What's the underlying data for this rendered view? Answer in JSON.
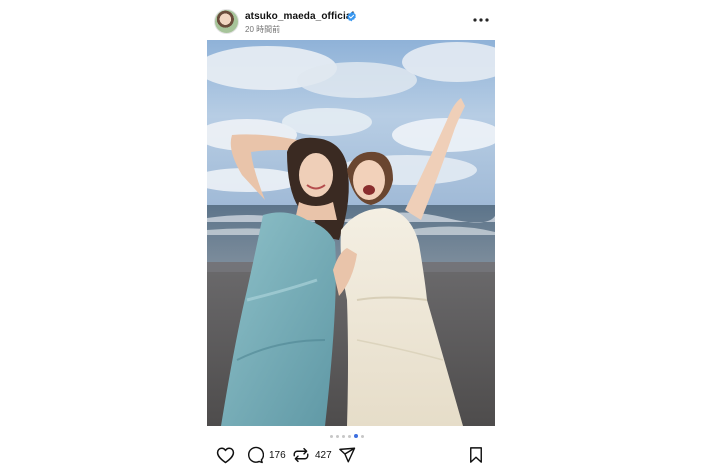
{
  "post": {
    "username": "atsuko_maeda_official",
    "time_ago": "20 時間前",
    "verified_icon": "verified-badge-icon",
    "more_icon": "more-options-icon",
    "photo_alt": "Two women posing with raised arms on a beach",
    "carousel": {
      "total": 6,
      "active_index": 4
    },
    "actions": {
      "like_icon": "heart-icon",
      "comment_icon": "comment-icon",
      "comment_count": "176",
      "repost_icon": "repost-icon",
      "repost_count": "427",
      "share_icon": "share-icon",
      "save_icon": "bookmark-icon"
    },
    "colors": {
      "verified": "#3897f0",
      "active_dot": "#3d6fe0",
      "inactive_dot": "#c7c7c7"
    }
  }
}
